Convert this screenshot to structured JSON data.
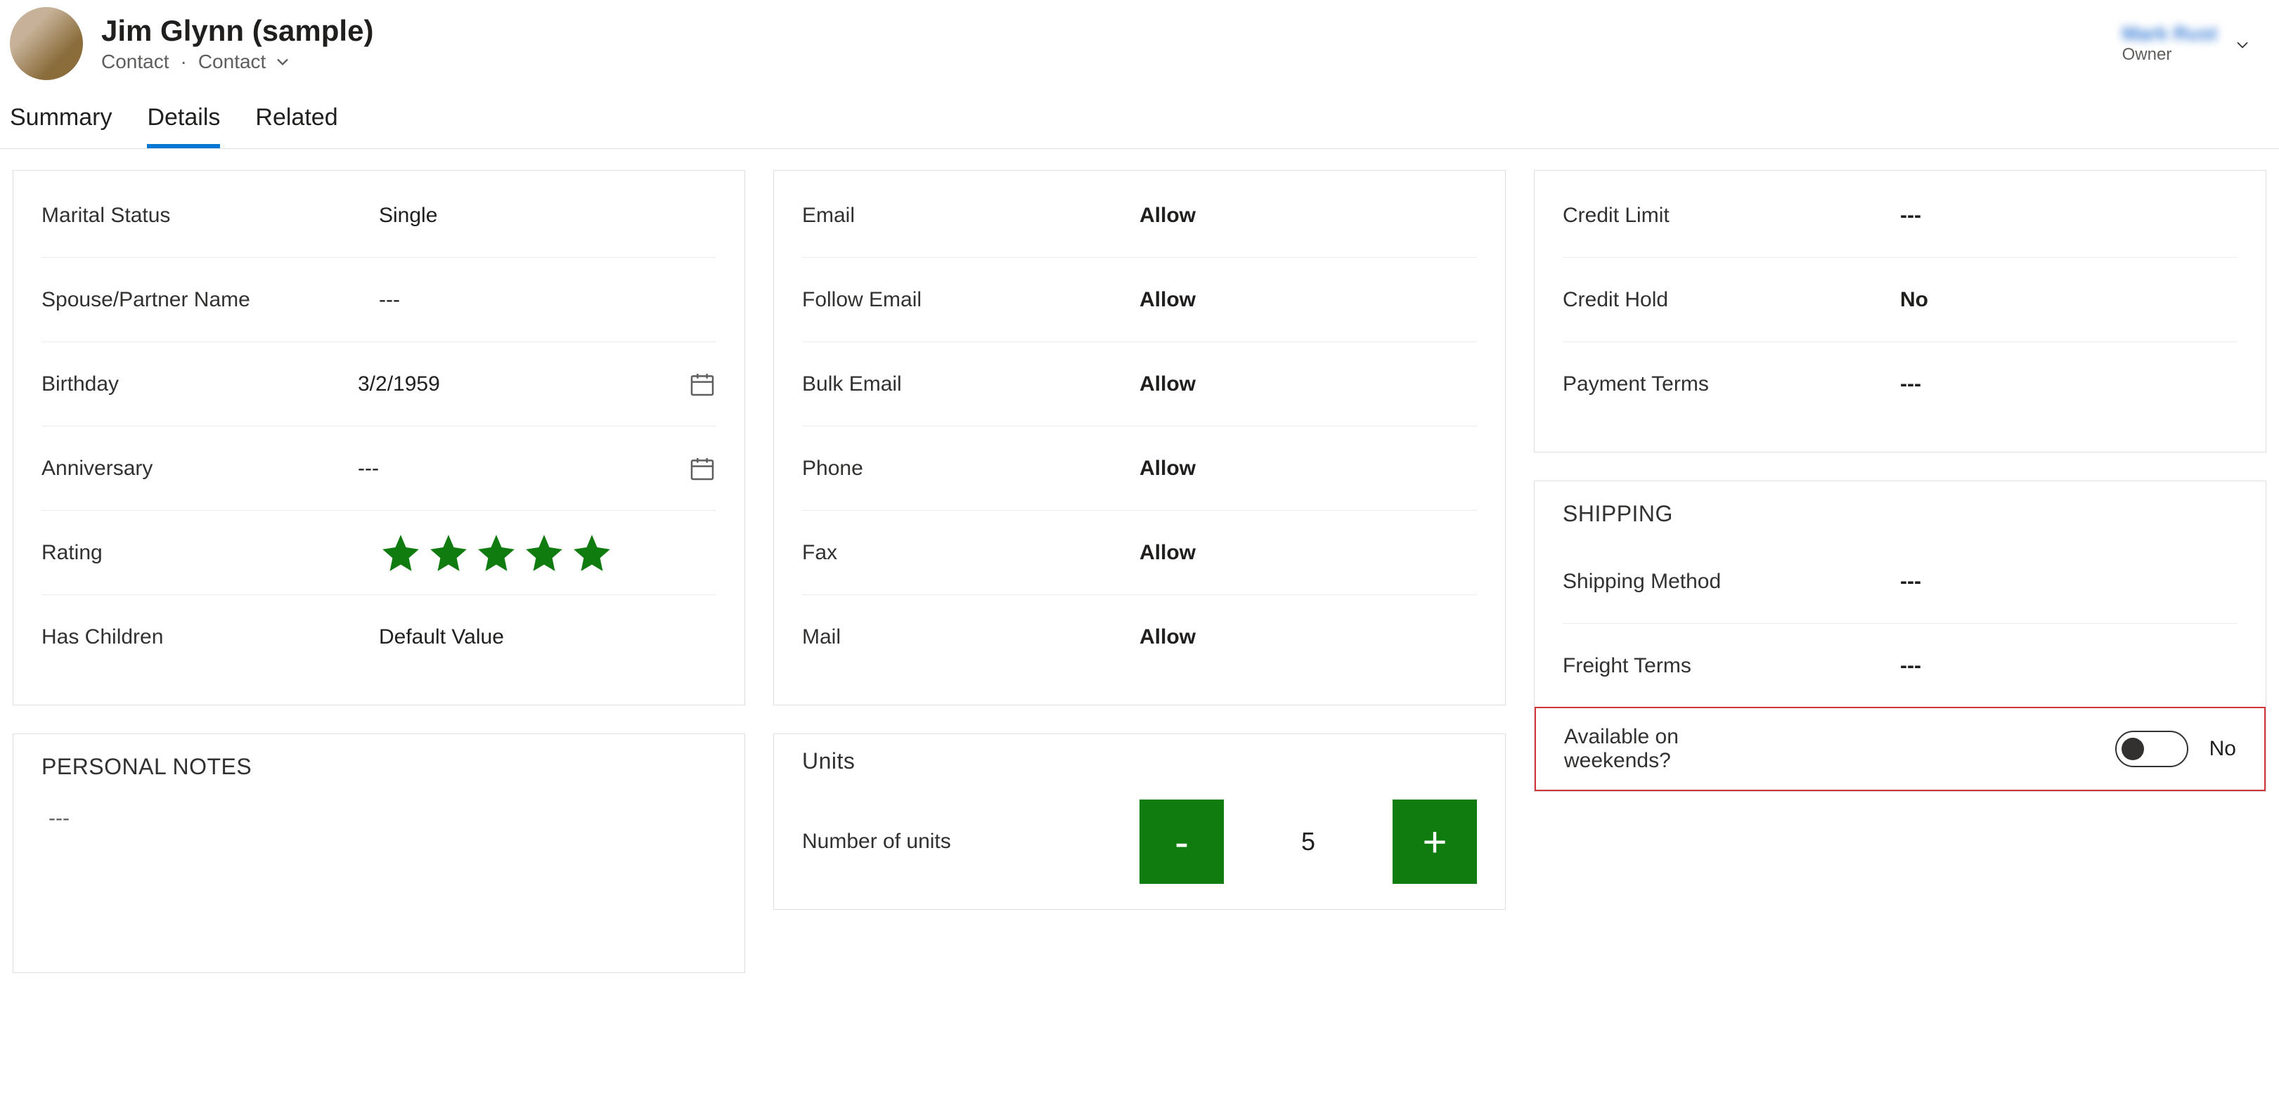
{
  "header": {
    "title": "Jim Glynn (sample)",
    "entity": "Contact",
    "subtype": "Contact",
    "owner_label": "Owner",
    "owner_name": "Mark Rust"
  },
  "tabs": [
    {
      "label": "Summary",
      "active": false
    },
    {
      "label": "Details",
      "active": true
    },
    {
      "label": "Related",
      "active": false
    }
  ],
  "personal": {
    "marital_status_label": "Marital Status",
    "marital_status_value": "Single",
    "spouse_label": "Spouse/Partner Name",
    "spouse_value": "---",
    "birthday_label": "Birthday",
    "birthday_value": "3/2/1959",
    "anniversary_label": "Anniversary",
    "anniversary_value": "---",
    "rating_label": "Rating",
    "rating_stars": 5,
    "has_children_label": "Has Children",
    "has_children_value": "Default Value"
  },
  "notes": {
    "title": "PERSONAL NOTES",
    "value": "---"
  },
  "prefs": {
    "email_label": "Email",
    "email_value": "Allow",
    "follow_email_label": "Follow Email",
    "follow_email_value": "Allow",
    "bulk_email_label": "Bulk Email",
    "bulk_email_value": "Allow",
    "phone_label": "Phone",
    "phone_value": "Allow",
    "fax_label": "Fax",
    "fax_value": "Allow",
    "mail_label": "Mail",
    "mail_value": "Allow"
  },
  "units": {
    "title": "Units",
    "label": "Number of units",
    "value": "5",
    "minus": "-",
    "plus": "+"
  },
  "billing": {
    "credit_limit_label": "Credit Limit",
    "credit_limit_value": "---",
    "credit_hold_label": "Credit Hold",
    "credit_hold_value": "No",
    "payment_terms_label": "Payment Terms",
    "payment_terms_value": "---"
  },
  "shipping": {
    "title": "SHIPPING",
    "method_label": "Shipping Method",
    "method_value": "---",
    "freight_label": "Freight Terms",
    "freight_value": "---",
    "weekends_label": "Available on weekends?",
    "weekends_value": "No"
  }
}
